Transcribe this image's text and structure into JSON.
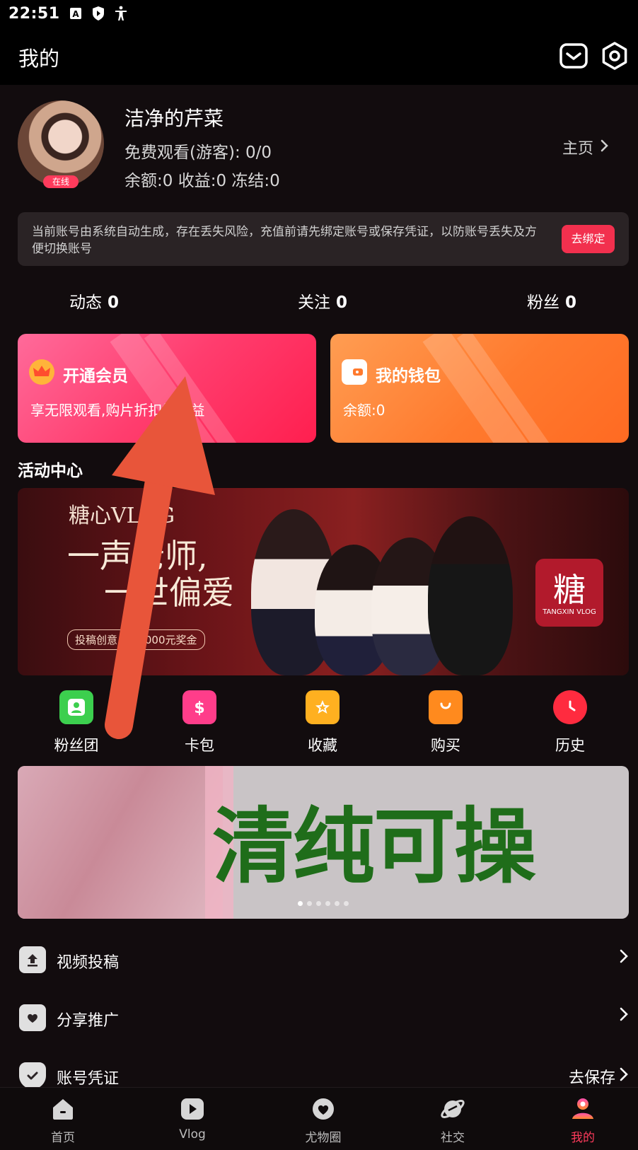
{
  "status_bar": {
    "time": "22:51"
  },
  "header": {
    "title": "我的"
  },
  "profile": {
    "username": "洁净的芹菜",
    "free_watch": "免费观看(游客): 0/0",
    "balance_line": "余额:0 收益:0 冻结:0",
    "online_badge": "在线",
    "homepage_link": "主页"
  },
  "notice": {
    "text": "当前账号由系统自动生成，存在丢失风险，充值前请先绑定账号或保存凭证，以防账号丢失及方便切换账号",
    "bind_button": "去绑定"
  },
  "stats": [
    {
      "label": "动态",
      "value": "0"
    },
    {
      "label": "关注",
      "value": "0"
    },
    {
      "label": "粉丝",
      "value": "0"
    }
  ],
  "cards": {
    "vip": {
      "title": "开通会员",
      "subtitle": "享无限观看,购片折扣等权益"
    },
    "wallet": {
      "title": "我的钱包",
      "subtitle": "余额:0"
    }
  },
  "activity": {
    "section_title": "活动中心",
    "banner_brand": "糖心VLOG",
    "banner_slogan_1": "一声老师,",
    "banner_slogan_2": "一世偏爱",
    "banner_prize": "投稿创意,赢10000元奖金",
    "banner_logo_char": "糖",
    "banner_logo_sub": "TANGXIN VLOG"
  },
  "quick_actions": [
    {
      "label": "粉丝团",
      "icon": "fan-group-icon",
      "color": "#3ccf4e"
    },
    {
      "label": "卡包",
      "icon": "card-wallet-icon",
      "color": "#ff3d8a"
    },
    {
      "label": "收藏",
      "icon": "star-icon",
      "color": "#ffb020"
    },
    {
      "label": "购买",
      "icon": "shopping-bag-icon",
      "color": "#ff8a1e"
    },
    {
      "label": "历史",
      "icon": "clock-icon",
      "color": "#ff2b3f"
    }
  ],
  "promo_banner": {
    "text": "清纯可操",
    "slide_count": 6,
    "active_slide": 1
  },
  "menu": [
    {
      "label": "视频投稿",
      "icon": "upload-icon",
      "right": ""
    },
    {
      "label": "分享推广",
      "icon": "share-heart-icon",
      "right": ""
    },
    {
      "label": "账号凭证",
      "icon": "shield-check-icon",
      "right": "去保存"
    }
  ],
  "bottom_nav": [
    {
      "label": "首页",
      "icon": "home-icon",
      "active": false
    },
    {
      "label": "Vlog",
      "icon": "play-icon",
      "active": false
    },
    {
      "label": "尤物圈",
      "icon": "heart-circle-icon",
      "active": false
    },
    {
      "label": "社交",
      "icon": "planet-icon",
      "active": false
    },
    {
      "label": "我的",
      "icon": "profile-icon",
      "active": true
    }
  ],
  "colors": {
    "accent": "#ff3b5c",
    "background": "#120c0e",
    "vip_card": "#ff3d6e",
    "wallet_card": "#ff7a2e",
    "annotation_arrow": "#e8553a"
  }
}
